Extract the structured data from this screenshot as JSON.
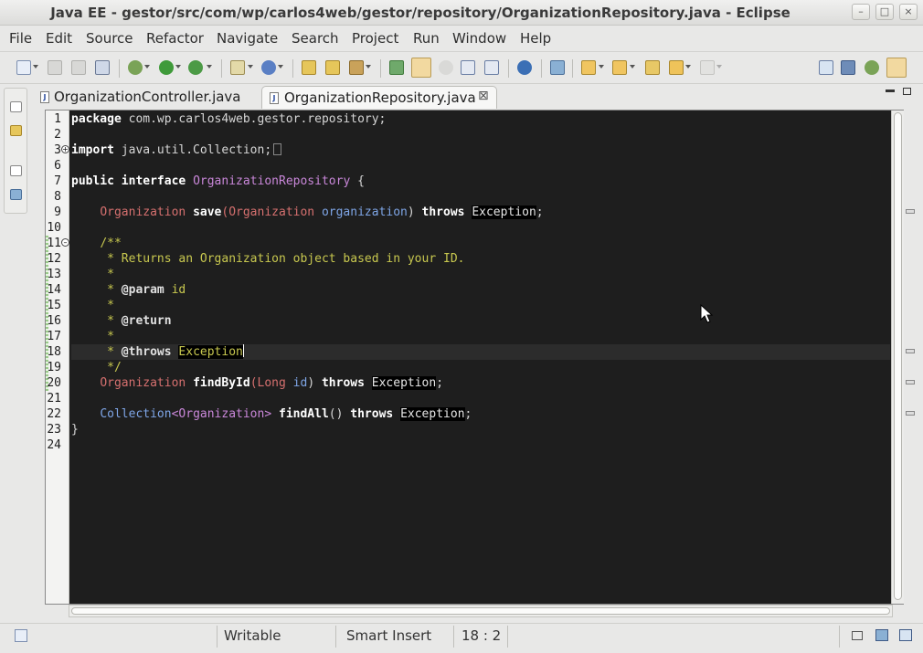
{
  "window": {
    "title": "Java EE - gestor/src/com/wp/carlos4web/gestor/repository/OrganizationRepository.java - Eclipse",
    "minimize": "–",
    "maximize": "□",
    "close": "×"
  },
  "menu": [
    "File",
    "Edit",
    "Source",
    "Refactor",
    "Navigate",
    "Search",
    "Project",
    "Run",
    "Window",
    "Help"
  ],
  "tabs": [
    {
      "label": "OrganizationController.java",
      "active": false
    },
    {
      "label": "OrganizationRepository.java",
      "active": true,
      "close": "⊠"
    }
  ],
  "editor": {
    "line_numbers": [
      "1",
      "2",
      "3",
      "6",
      "7",
      "8",
      "9",
      "10",
      "11",
      "12",
      "13",
      "14",
      "15",
      "16",
      "17",
      "18",
      "19",
      "20",
      "21",
      "22",
      "23",
      "24"
    ],
    "code": {
      "l1_kw": "package",
      "l1_pkg": " com.wp.carlos4web.gestor.repository;",
      "l3_kw": "import",
      "l3_rest": " java.util.Collection;",
      "l7_kw1": "public",
      "l7_kw2": "interface",
      "l7_name": "OrganizationRepository",
      "l7_brace": " {",
      "l9_type": "Organization",
      "l9_method": "save",
      "l9_paren": "(",
      "l9_ptype": "Organization",
      "l9_pname": "organization",
      "l9_close": ")",
      "l9_throws": "throws",
      "l9_exc": "Exception",
      "l9_semi": ";",
      "l11": "/**",
      "l12": " * Returns an Organization object based in your ID.",
      "l13": " *",
      "l14_star": " * ",
      "l14_tag": "@param",
      "l14_rest": " id",
      "l15": " *",
      "l16_star": " * ",
      "l16_tag": "@return",
      "l17": " *",
      "l18_star": " * ",
      "l18_tag": "@throws",
      "l18_exc": "Exception",
      "l19": " */",
      "l20_type": "Organization",
      "l20_method": "findById",
      "l20_paren": "(",
      "l20_ptype": "Long",
      "l20_pname": "id",
      "l20_close": ")",
      "l20_throws": "throws",
      "l20_exc": "Exception",
      "l20_semi": ";",
      "l22_type": "Collection",
      "l22_generic": "<Organization>",
      "l22_method": "findAll",
      "l22_parens": "()",
      "l22_throws": "throws",
      "l22_exc": "Exception",
      "l22_semi": ";",
      "l23": "}"
    },
    "fold_expand": "+",
    "fold_collapse": "–"
  },
  "status": {
    "writable": "Writable",
    "insert_mode": "Smart Insert",
    "position": "18 : 2"
  },
  "colors": {
    "editor_bg": "#1e1e1e",
    "keyword": "#ffffff",
    "type": "#d6706f",
    "interface_name": "#c987d9",
    "parameter": "#7ea5e6",
    "javadoc": "#c8c84f"
  }
}
